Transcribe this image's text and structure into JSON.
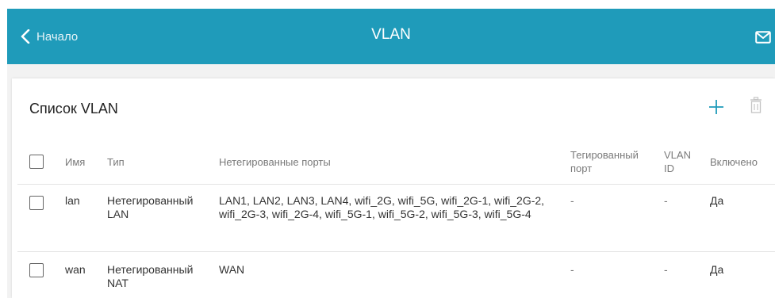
{
  "header": {
    "back_label": "Начало",
    "title": "VLAN",
    "accent_color": "#1f9bba",
    "icons": [
      "chevron-left-icon",
      "mail-icon"
    ]
  },
  "card": {
    "title": "Список VLAN",
    "icons": [
      "plus-icon",
      "trash-icon"
    ]
  },
  "table": {
    "columns": {
      "name": "Имя",
      "type": "Тип",
      "untagged": "Нетегированные порты",
      "tagged_line1": "Тегированный",
      "tagged_line2": "порт",
      "vlanid_line1": "VLAN",
      "vlanid_line2": "ID",
      "enabled": "Включено"
    },
    "rows": [
      {
        "name": "lan",
        "type_line1": "Нетегированный",
        "type_line2": "LAN",
        "untagged_ports": "LAN1, LAN2, LAN3, LAN4, wifi_2G, wifi_5G, wifi_2G-1, wifi_2G-2, wifi_2G-3, wifi_2G-4, wifi_5G-1, wifi_5G-2, wifi_5G-3, wifi_5G-4",
        "tagged_port": "-",
        "vlan_id": "-",
        "enabled": "Да"
      },
      {
        "name": "wan",
        "type_line1": "Нетегированный",
        "type_line2": "NAT",
        "untagged_ports": "WAN",
        "tagged_port": "-",
        "vlan_id": "-",
        "enabled": "Да"
      }
    ]
  }
}
